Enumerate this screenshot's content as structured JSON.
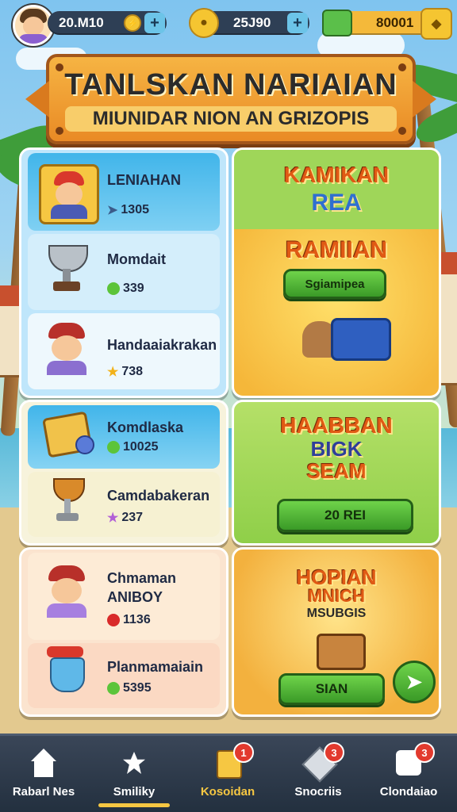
{
  "top_bar": {
    "currency1": "20.M10",
    "currency2": "25J90",
    "currency3": "80001",
    "plus": "+"
  },
  "banner": {
    "title": "TANLSKAN NARIAIAN",
    "subtitle": "MIUNIDAR NION AN GRIZOPIS"
  },
  "left_panel_1": {
    "items": [
      {
        "label": "LENIAHAN",
        "value": "1305"
      },
      {
        "label": "Momdait",
        "value": "339"
      },
      {
        "label": "Handaaiakrakan",
        "value": "738"
      }
    ]
  },
  "left_panel_2": {
    "items": [
      {
        "label": "Komdlaska",
        "value": "10025"
      },
      {
        "label": "Camdabakeran",
        "value": "237"
      }
    ]
  },
  "left_panel_3": {
    "items": [
      {
        "label": "Chmaman",
        "label2": "ANIBOY",
        "value": "1136"
      },
      {
        "label": "Planmamaiain",
        "value": "5395"
      }
    ]
  },
  "offer_1": {
    "title": "KAMIKAN",
    "subtitle": "REA",
    "heading": "RAMIIAN",
    "button": "Sgiamipea"
  },
  "offer_2": {
    "title": "HAABBAN",
    "subtitle": "BIGK",
    "subtitle2": "SEAM",
    "button": "20 REI"
  },
  "offer_3": {
    "title": "HOPIAN",
    "subtitle": "MNICH",
    "subtitle2": "MSUBGIS",
    "button": "SIAN"
  },
  "nav": [
    {
      "label": "Rabarl Nes",
      "badge": ""
    },
    {
      "label": "Smiliky",
      "badge": ""
    },
    {
      "label": "Kosoidan",
      "badge": "1"
    },
    {
      "label": "Snocriis",
      "badge": "3"
    },
    {
      "label": "Clondaiao",
      "badge": "3"
    }
  ],
  "colors": {
    "accent": "#f6c742",
    "banner": "#e98a25",
    "green_button": "#3a9a27",
    "panel_blue": "#bfe6fb",
    "panel_yellow": "#f8e7b2"
  }
}
